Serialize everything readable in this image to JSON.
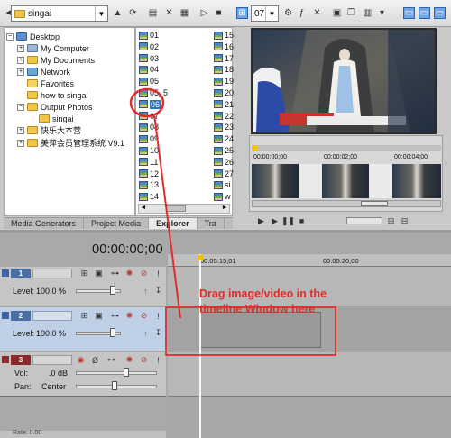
{
  "explorer": {
    "path_value": "singai",
    "tree": [
      {
        "label": "Desktop",
        "expander": "−"
      },
      {
        "label": "My Computer",
        "expander": "+"
      },
      {
        "label": "My Documents",
        "expander": "+"
      },
      {
        "label": "Network",
        "expander": "+"
      },
      {
        "label": "Favorites",
        "expander": ""
      },
      {
        "label": "how to singai",
        "expander": ""
      },
      {
        "label": "Output Photos",
        "expander": "−"
      },
      {
        "label": "singai",
        "expander": ""
      },
      {
        "label": "快乐大本营",
        "expander": "+"
      },
      {
        "label": "美萍会员管理系统 V9.1",
        "expander": "+"
      }
    ],
    "files_col1": [
      "01",
      "02",
      "03",
      "04",
      "05",
      "05_5",
      "06",
      "07",
      "08",
      "09",
      "10",
      "11",
      "12",
      "13",
      "14"
    ],
    "files_col2": [
      "15",
      "16",
      "17",
      "18",
      "19",
      "20",
      "21",
      "22",
      "23",
      "24",
      "25",
      "26",
      "27",
      "si",
      "w"
    ],
    "selected_file": "06"
  },
  "tabs": [
    "Media Generators",
    "Project Media",
    "Explorer",
    "Tra"
  ],
  "active_tab": "Explorer",
  "preview": {
    "zoom_value": "07",
    "mini_times": [
      "00:00:00;00",
      "00:00:02;00",
      "00:00:04;00"
    ]
  },
  "timeline": {
    "timecode": "00:00:00;00",
    "ruler": [
      "00:05:15;01",
      "00:05:20;00"
    ],
    "tracks": [
      {
        "num": "1",
        "kind": "video",
        "level_label": "Level:",
        "level_value": "100.0 %"
      },
      {
        "num": "2",
        "kind": "video",
        "level_label": "Level:",
        "level_value": "100.0 %"
      },
      {
        "num": "3",
        "kind": "audio",
        "vol_label": "Vol:",
        "vol_value": ".0 dB",
        "pan_label": "Pan:",
        "pan_value": "Center"
      }
    ],
    "status_text": "Rate: 0.00"
  },
  "annotation": {
    "line1": "Drag image/video in the",
    "line2": "timeline Window here"
  },
  "colors": {
    "annotation": "#e32b2b",
    "track_video": "#4a6fa5",
    "track_audio": "#8b2a2a",
    "selected_track_bg": "#bfcfe6"
  }
}
